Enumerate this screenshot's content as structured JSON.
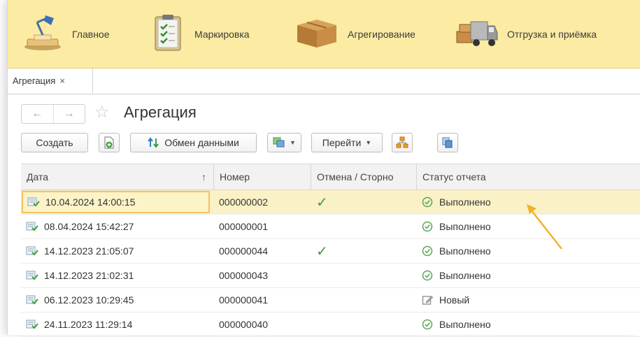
{
  "sections": [
    {
      "label": "Главное",
      "icon": "desk-lamp-icon"
    },
    {
      "label": "Маркировка",
      "icon": "clipboard-check-icon"
    },
    {
      "label": "Агрегирование",
      "icon": "box-icon"
    },
    {
      "label": "Отгрузка и приёмка",
      "icon": "truck-icon"
    }
  ],
  "tab": {
    "label": "Агрегация",
    "close": "×"
  },
  "page": {
    "title": "Агрегация"
  },
  "toolbar": {
    "create_label": "Создать",
    "exchange_label": "Обмен данными",
    "goto_label": "Перейти"
  },
  "table": {
    "columns": [
      "Дата",
      "Номер",
      "Отмена / Сторно",
      "Статус отчета"
    ],
    "sort_indicator": "↑",
    "rows": [
      {
        "date": "10.04.2024 14:00:15",
        "number": "000000002",
        "cancel": "✓",
        "status": "Выполнено",
        "status_icon": "check-circle-icon",
        "selected": true
      },
      {
        "date": "08.04.2024 15:42:27",
        "number": "000000001",
        "cancel": "",
        "status": "Выполнено",
        "status_icon": "check-circle-icon"
      },
      {
        "date": "14.12.2023 21:05:07",
        "number": "000000044",
        "cancel": "✓",
        "status": "Выполнено",
        "status_icon": "check-circle-icon"
      },
      {
        "date": "14.12.2023 21:02:31",
        "number": "000000043",
        "cancel": "",
        "status": "Выполнено",
        "status_icon": "check-circle-icon"
      },
      {
        "date": "06.12.2023 10:29:45",
        "number": "000000041",
        "cancel": "",
        "status": "Новый",
        "status_icon": "edit-icon"
      },
      {
        "date": "24.11.2023 11:29:14",
        "number": "000000040",
        "cancel": "",
        "status": "Выполнено",
        "status_icon": "check-circle-icon"
      }
    ]
  },
  "colors": {
    "section_bar": "#fbeba3",
    "selected_row": "#fbf1c6",
    "arrow": "#f0b429",
    "check": "#3e9a3b"
  }
}
